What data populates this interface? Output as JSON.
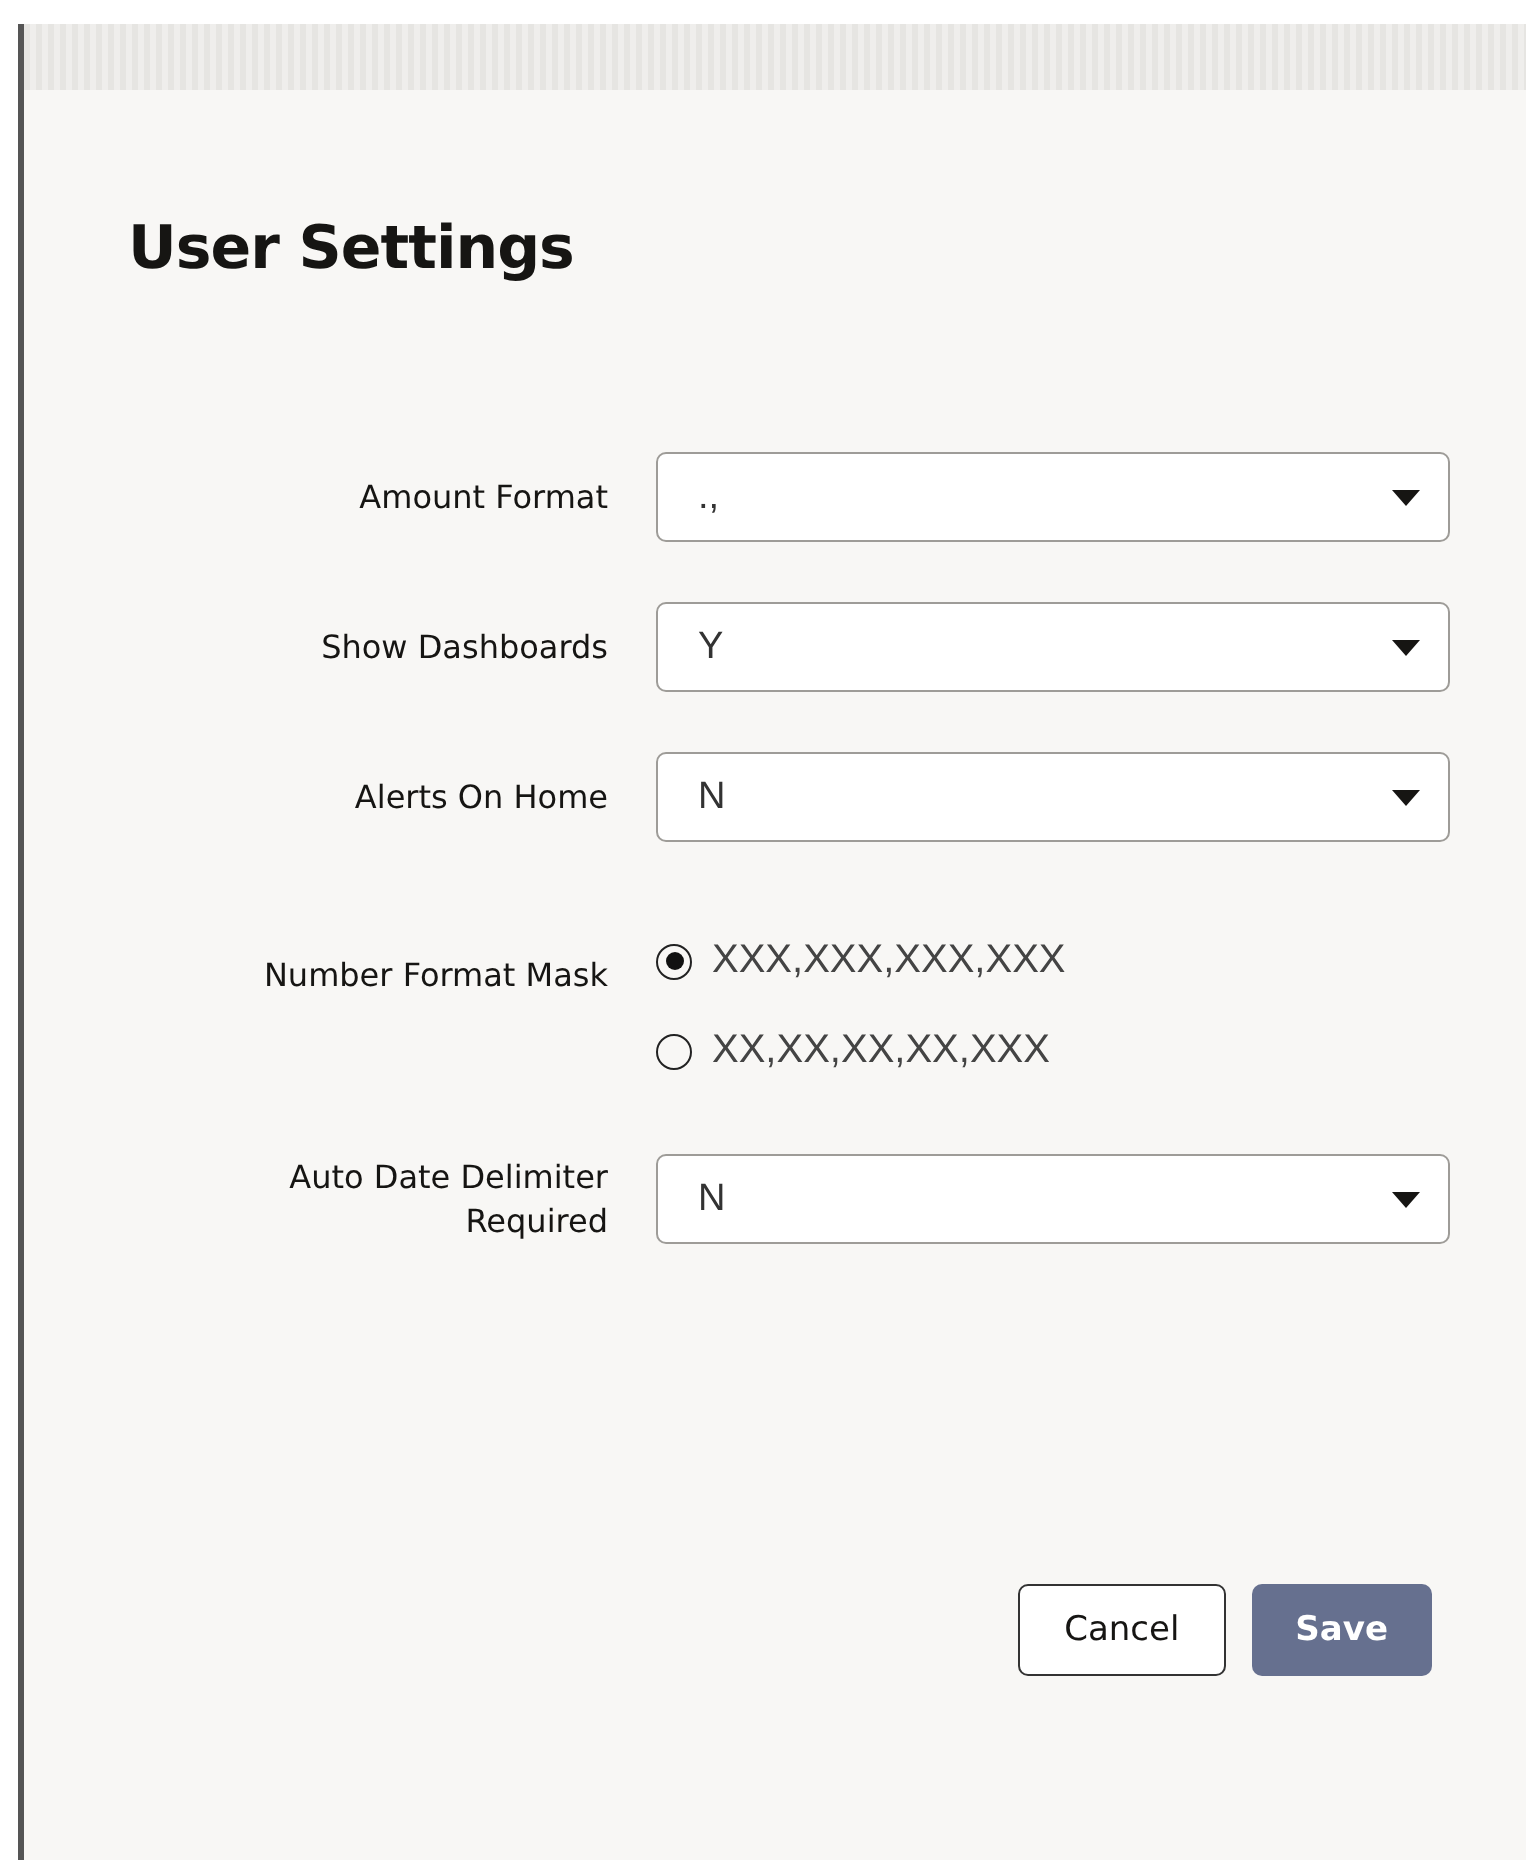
{
  "dialog": {
    "title": "User Settings"
  },
  "fields": [
    {
      "kind": "select",
      "label": "Amount Format",
      "value": ".,"
    },
    {
      "kind": "select",
      "label": "Show Dashboards",
      "value": "Y"
    },
    {
      "kind": "select",
      "label": "Alerts On Home",
      "value": "N"
    },
    {
      "kind": "radio",
      "label": "Number Format Mask",
      "options": [
        {
          "label": "XXX,XXX,XXX,XXX",
          "selected": true
        },
        {
          "label": "XX,XX,XX,XX,XXX",
          "selected": false
        }
      ]
    },
    {
      "kind": "select",
      "label": "Auto Date Delimiter Required",
      "value": "N"
    }
  ],
  "buttons": [
    {
      "kind": "secondary",
      "label": "Cancel"
    },
    {
      "kind": "primary",
      "label": "Save"
    }
  ]
}
